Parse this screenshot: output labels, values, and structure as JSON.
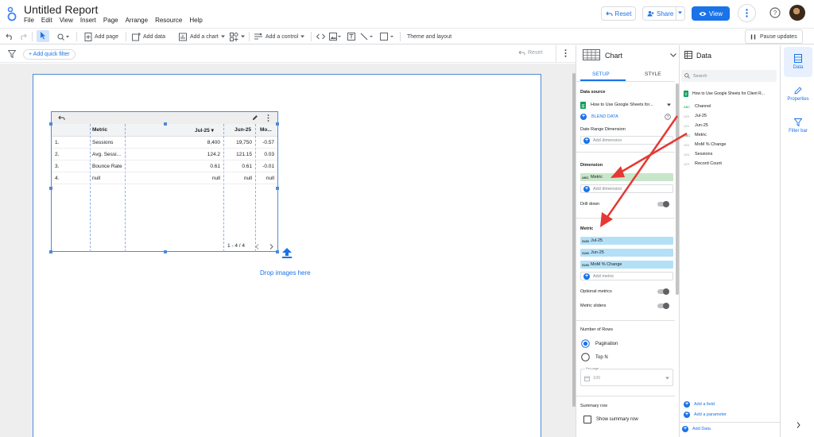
{
  "header": {
    "title": "Untitled Report",
    "menu": [
      "File",
      "Edit",
      "View",
      "Insert",
      "Page",
      "Arrange",
      "Resource",
      "Help"
    ],
    "reset_label": "Reset",
    "share_label": "Share",
    "view_label": "View"
  },
  "toolbar": {
    "add_page": "Add page",
    "add_data": "Add data",
    "add_chart": "Add a chart",
    "add_control": "Add a control",
    "theme": "Theme and layout",
    "pause": "Pause updates"
  },
  "filterbar": {
    "add_filter": "+ Add quick filter",
    "reset": "Reset"
  },
  "table": {
    "columns": [
      "Metric",
      "Jul-25 ▾",
      "Jun-25",
      "Mo..."
    ],
    "rows": [
      {
        "n": "1.",
        "metric": "Sessions",
        "jul": "8,400",
        "jun": "19,750",
        "mom": "-0.57"
      },
      {
        "n": "2.",
        "metric": "Avg. Sessi...",
        "jul": "124.2",
        "jun": "121.15",
        "mom": "0.03"
      },
      {
        "n": "3.",
        "metric": "Bounce Rate",
        "jul": "0.61",
        "jun": "0.61",
        "mom": "-0.01"
      },
      {
        "n": "4.",
        "metric": "null",
        "jul": "null",
        "jun": "null",
        "mom": "null"
      }
    ],
    "pagination": "1 - 4 / 4"
  },
  "canvas": {
    "drop_text": "Drop images here"
  },
  "chart_panel": {
    "title": "Chart",
    "tab_setup": "SETUP",
    "tab_style": "STYLE",
    "data_source_label": "Data source",
    "data_source_value": "How to Use Google Sheets for...",
    "blend_data": "BLEND DATA",
    "date_range_label": "Date Range Dimension",
    "add_dimension": "Add dimension",
    "dimension_label": "Dimension",
    "dimension_chip": "Metric",
    "dimension_tag": "ABC",
    "drill_down": "Drill down",
    "metric_label": "Metric",
    "metrics": [
      {
        "tag": "SUM",
        "name": "Jul-25"
      },
      {
        "tag": "SUM",
        "name": "Jun-25"
      },
      {
        "tag": "SUM",
        "name": "MoM % Change"
      }
    ],
    "add_metric": "Add metric",
    "optional_metrics": "Optional metrics",
    "metric_sliders": "Metric sliders",
    "rows_label": "Number of Rows",
    "pagination": "Pagination",
    "top_n": "Top N",
    "per_page_label": "Per page",
    "per_page_value": "100",
    "summary_label": "Summary row",
    "show_summary": "Show summary row"
  },
  "data_panel": {
    "title": "Data",
    "search_placeholder": "Search",
    "source_name": "How to Use Google Sheets for Client R...",
    "fields": [
      {
        "type": "ABC",
        "name": "Channel"
      },
      {
        "type": "123",
        "name": "Jul-25"
      },
      {
        "type": "123",
        "name": "Jun-25"
      },
      {
        "type": "ABC",
        "name": "Metric"
      },
      {
        "type": "123",
        "name": "MoM % Change"
      },
      {
        "type": "123",
        "name": "Sessions"
      },
      {
        "type": "123",
        "name": "Record Count"
      }
    ],
    "add_field": "Add a field",
    "add_parameter": "Add a parameter",
    "add_data": "Add Data"
  },
  "sidebar": {
    "data": "Data",
    "properties": "Properties",
    "filter_bar": "Filter bar"
  },
  "colors": {
    "accent": "#1a73e8",
    "dimension_chip": "#c8e6c9",
    "metric_chip": "#b3e0f7",
    "annotation_arrow": "#e53935"
  }
}
